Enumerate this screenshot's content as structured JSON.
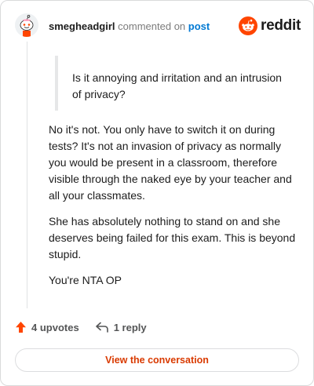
{
  "header": {
    "author": "smegheadgirl",
    "action": "commented on",
    "post_link": "post",
    "brand": "reddit",
    "avatar_icon": "snoo-avatar-icon",
    "brand_icon": "reddit-logo-icon"
  },
  "comment": {
    "quote": "Is it annoying and irritation and an intrusion of privacy?",
    "paragraphs": [
      "No it's not. You only have to switch it on during tests? It's not an invasion of privacy as normally you would be present in a classroom, therefore visible through the naked eye by your teacher and all your classmates.",
      "She has absolutely nothing to stand on and she deserves being failed for this exam. This is beyond stupid.",
      "You're NTA OP"
    ]
  },
  "actions": {
    "upvotes": "4 upvotes",
    "reply": "1 reply",
    "view_conversation": "View the conversation"
  },
  "colors": {
    "upvote": "#ff4500",
    "link": "#0079d3",
    "view_button_text": "#d93a00",
    "brand": "#ff4500"
  }
}
